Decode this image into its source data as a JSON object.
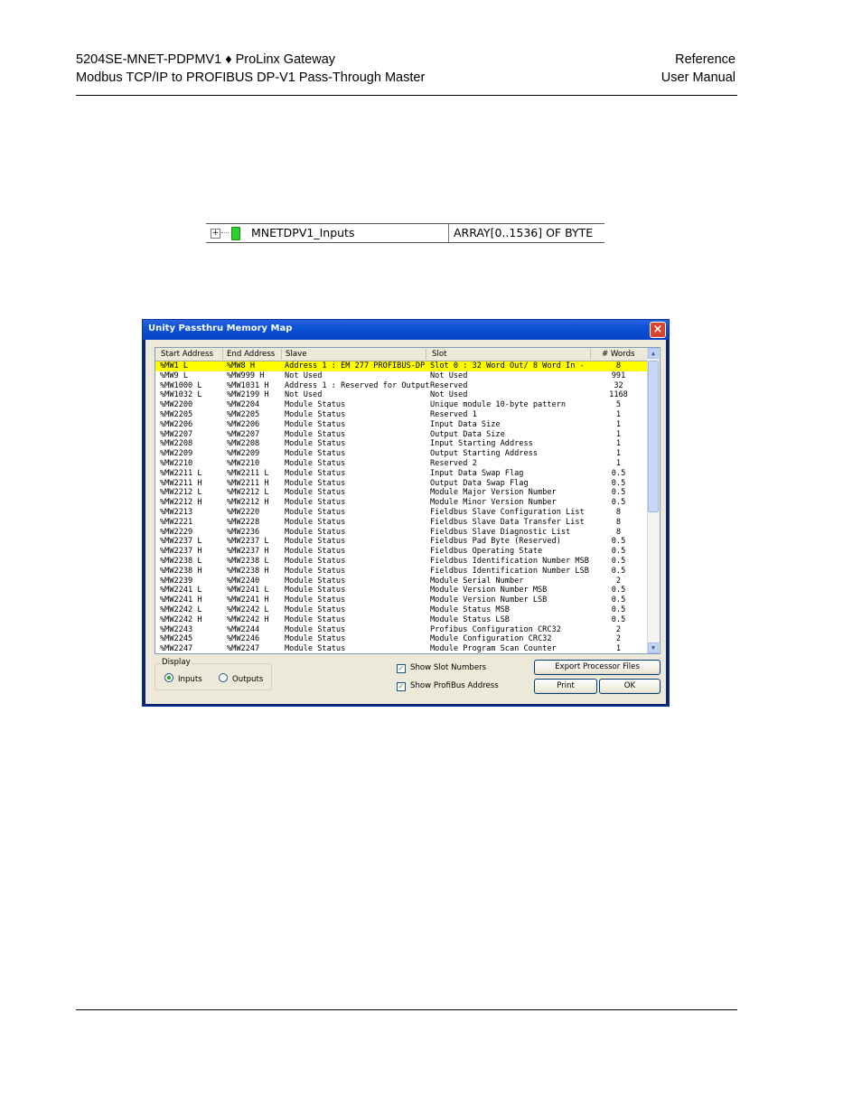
{
  "header": {
    "left_line1": "5204SE-MNET-PDPMV1 ♦ ProLinx Gateway",
    "left_line2": "Modbus TCP/IP to PROFIBUS DP-V1 Pass-Through Master",
    "right_line1": "Reference",
    "right_line2": "User Manual"
  },
  "variable": {
    "expand": "+",
    "name": "MNETDPV1_Inputs",
    "type": "ARRAY[0..1536] OF BYTE",
    "block_color": "#2fd12f"
  },
  "dialog": {
    "title": "Unity Passthru Memory Map",
    "close": "×",
    "columns": [
      "Start Address",
      "End Address",
      "Slave",
      "Slot",
      "# Words"
    ],
    "rows": [
      [
        "%MW1 L",
        "%MW8 H",
        "Address 1 : EM 277 PROFIBUS-DP",
        "Slot 0 : 32 Word Out/ 8 Word In      -",
        "8"
      ],
      [
        "%MW9 L",
        "%MW999 H",
        "Not Used",
        "Not Used",
        "991"
      ],
      [
        "%MW1000 L",
        "%MW1031 H",
        "Address 1 : Reserved for Output",
        "Reserved",
        "32"
      ],
      [
        "%MW1032 L",
        "%MW2199 H",
        "Not Used",
        "Not Used",
        "1168"
      ],
      [
        "%MW2200",
        "%MW2204",
        "Module Status",
        "Unique module 10-byte pattern",
        "5"
      ],
      [
        "%MW2205",
        "%MW2205",
        "Module Status",
        "Reserved 1",
        "1"
      ],
      [
        "%MW2206",
        "%MW2206",
        "Module Status",
        "Input Data Size",
        "1"
      ],
      [
        "%MW2207",
        "%MW2207",
        "Module Status",
        "Output Data Size",
        "1"
      ],
      [
        "%MW2208",
        "%MW2208",
        "Module Status",
        "Input Starting Address",
        "1"
      ],
      [
        "%MW2209",
        "%MW2209",
        "Module Status",
        "Output Starting Address",
        "1"
      ],
      [
        "%MW2210",
        "%MW2210",
        "Module Status",
        "Reserved 2",
        "1"
      ],
      [
        "%MW2211 L",
        "%MW2211 L",
        "Module Status",
        "Input Data Swap Flag",
        "0.5"
      ],
      [
        "%MW2211 H",
        "%MW2211 H",
        "Module Status",
        "Output Data Swap Flag",
        "0.5"
      ],
      [
        "%MW2212 L",
        "%MW2212 L",
        "Module Status",
        "Module Major Version Number",
        "0.5"
      ],
      [
        "%MW2212 H",
        "%MW2212 H",
        "Module Status",
        "Module Minor Version Number",
        "0.5"
      ],
      [
        "%MW2213",
        "%MW2220",
        "Module Status",
        "Fieldbus Slave Configuration List",
        "8"
      ],
      [
        "%MW2221",
        "%MW2228",
        "Module Status",
        "Fieldbus Slave Data Transfer List",
        "8"
      ],
      [
        "%MW2229",
        "%MW2236",
        "Module Status",
        "Fieldbus Slave Diagnostic List",
        "8"
      ],
      [
        "%MW2237 L",
        "%MW2237 L",
        "Module Status",
        "Fieldbus Pad Byte (Reserved)",
        "0.5"
      ],
      [
        "%MW2237 H",
        "%MW2237 H",
        "Module Status",
        "Fieldbus Operating State",
        "0.5"
      ],
      [
        "%MW2238 L",
        "%MW2238 L",
        "Module Status",
        "Fieldbus Identification Number MSB",
        "0.5"
      ],
      [
        "%MW2238 H",
        "%MW2238 H",
        "Module Status",
        "Fieldbus Identification Number LSB",
        "0.5"
      ],
      [
        "%MW2239",
        "%MW2240",
        "Module Status",
        "Module Serial Number",
        "2"
      ],
      [
        "%MW2241 L",
        "%MW2241 L",
        "Module Status",
        "Module Version Number MSB",
        "0.5"
      ],
      [
        "%MW2241 H",
        "%MW2241 H",
        "Module Status",
        "Module Version Number LSB",
        "0.5"
      ],
      [
        "%MW2242 L",
        "%MW2242 L",
        "Module Status",
        "Module Status MSB",
        "0.5"
      ],
      [
        "%MW2242 H",
        "%MW2242 H",
        "Module Status",
        "Module Status LSB",
        "0.5"
      ],
      [
        "%MW2243",
        "%MW2244",
        "Module Status",
        "Profibus Configuration CRC32",
        "2"
      ],
      [
        "%MW2245",
        "%MW2246",
        "Module Status",
        "Module Configuration CRC32",
        "2"
      ],
      [
        "%MW2247",
        "%MW2247",
        "Module Status",
        "Module Program Scan Counter",
        "1"
      ]
    ],
    "selected_row": 0,
    "selected_color": "#ffff00",
    "display_label": "Display",
    "radio_inputs": "Inputs",
    "radio_outputs": "Outputs",
    "display_selected": "Inputs",
    "check_slot": "Show Slot Numbers",
    "check_slot_checked": true,
    "check_profibus": "Show ProfiBus Address",
    "check_profibus_checked": true,
    "btn_export": "Export Processor Files",
    "btn_print": "Print",
    "btn_ok": "OK"
  }
}
